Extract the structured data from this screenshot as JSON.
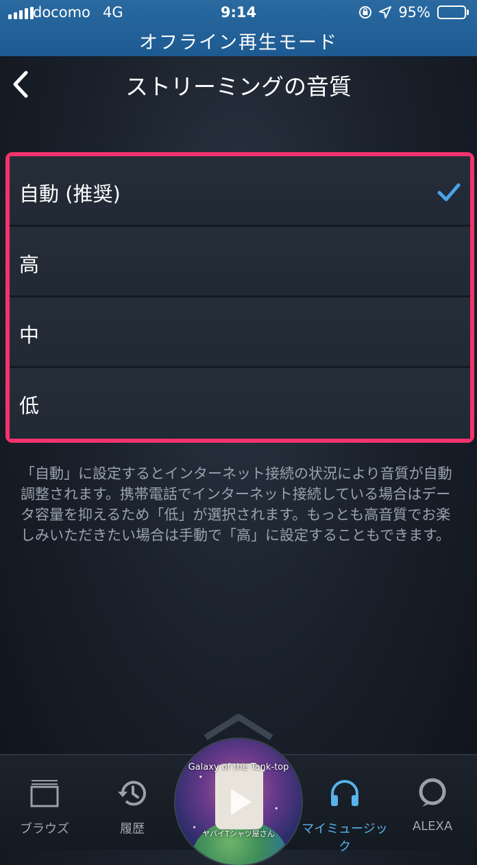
{
  "status_bar": {
    "carrier": "docomo",
    "network": "4G",
    "time": "9:14",
    "battery_percent_label": "95%",
    "battery_level": 0.95
  },
  "offline_banner": "オフライン再生モード",
  "header": {
    "title": "ストリーミングの音質",
    "back_icon": "chevron-left-icon"
  },
  "options": [
    {
      "label": "自動 (推奨)",
      "selected": true
    },
    {
      "label": "高",
      "selected": false
    },
    {
      "label": "中",
      "selected": false
    },
    {
      "label": "低",
      "selected": false
    }
  ],
  "description": "「自動」に設定するとインターネット接続の状況により音質が自動調整されます。携帯電話でインターネット接続している場合はデータ容量を抑えるため「低」が選択されます。もっとも高音質でお楽しみいただきたい場合は手動で「高」に設定することもできます。",
  "now_playing": {
    "title": "Galaxy of the Tank-top",
    "artist": "ヤバイTシャツ屋さん"
  },
  "tabs": [
    {
      "label": "ブラウズ",
      "icon": "browse-icon",
      "active": false
    },
    {
      "label": "履歴",
      "icon": "history-icon",
      "active": false
    },
    {
      "label": "マイミュージック",
      "icon": "headphones-icon",
      "active": true
    },
    {
      "label": "ALEXA",
      "icon": "alexa-icon",
      "active": false
    }
  ],
  "colors": {
    "accent": "#59b3ec",
    "highlight_frame": "#f2336d",
    "banner": "#1d5a92"
  }
}
